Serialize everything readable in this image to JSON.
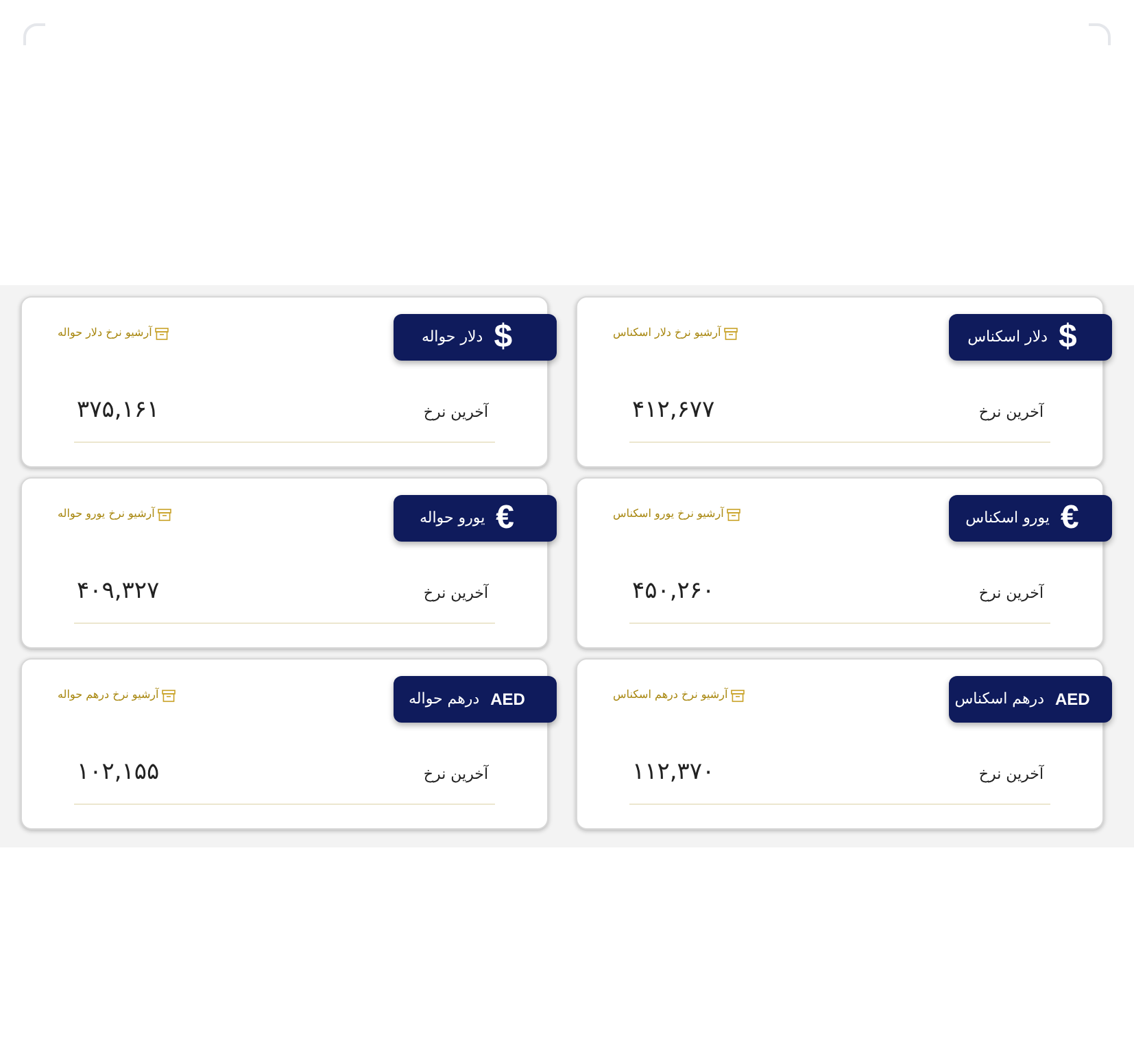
{
  "cards": [
    {
      "symbol": "$",
      "kind": "icon",
      "title": "دلار اسکناس",
      "archive": "آرشیو نرخ دلار اسکناس",
      "label": "آخرین نرخ",
      "value": "۴۱۲,۶۷۷"
    },
    {
      "symbol": "$",
      "kind": "icon",
      "title": "دلار حواله",
      "archive": "آرشیو نرخ دلار حواله",
      "label": "آخرین نرخ",
      "value": "۳۷۵,۱۶۱"
    },
    {
      "symbol": "€",
      "kind": "icon",
      "title": "یورو اسکناس",
      "archive": "آرشیو نرخ یورو اسکناس",
      "label": "آخرین نرخ",
      "value": "۴۵۰,۲۶۰"
    },
    {
      "symbol": "€",
      "kind": "icon",
      "title": "یورو حواله",
      "archive": "آرشیو نرخ یورو حواله",
      "label": "آخرین نرخ",
      "value": "۴۰۹,۳۲۷"
    },
    {
      "symbol": "AED",
      "kind": "code",
      "title": "درهم اسکناس",
      "archive": "آرشیو نرخ درهم اسکناس",
      "label": "آخرین نرخ",
      "value": "۱۱۲,۳۷۰"
    },
    {
      "symbol": "AED",
      "kind": "code",
      "title": "درهم حواله",
      "archive": "آرشیو نرخ درهم حواله",
      "label": "آخرین نرخ",
      "value": "۱۰۲,۱۵۵"
    }
  ]
}
